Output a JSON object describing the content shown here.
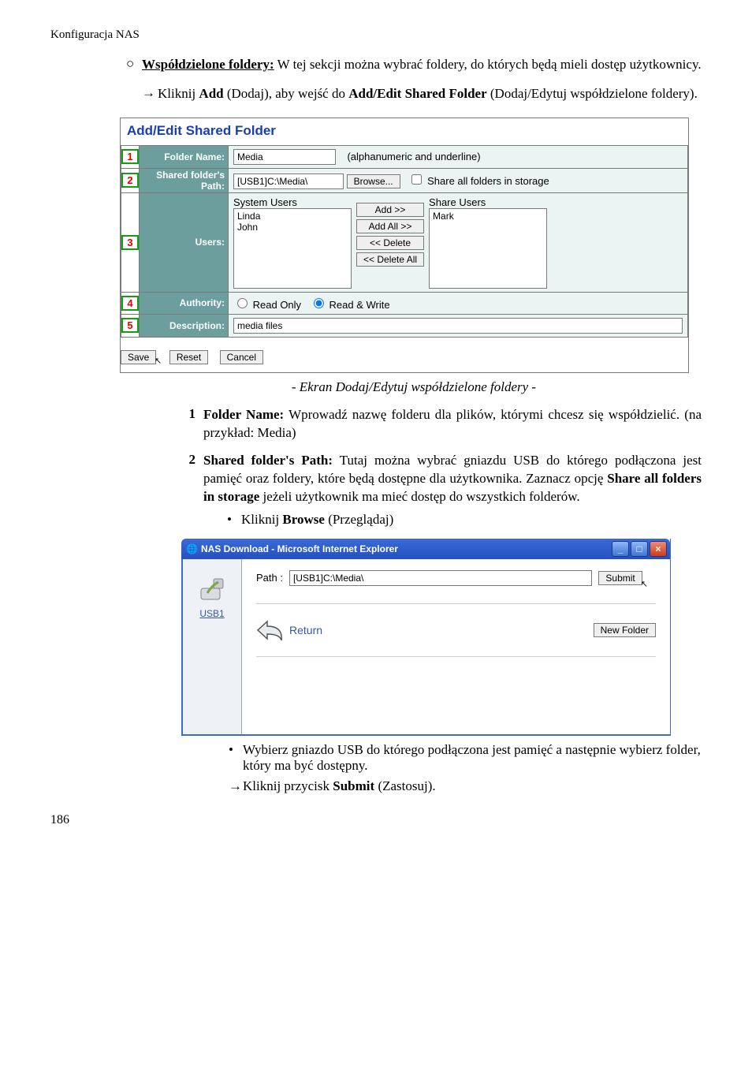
{
  "header": "Konfiguracja NAS",
  "shared_section": {
    "heading": "Współdzielone foldery:",
    "text": " W tej sekcji można wybrać foldery, do których będą mieli dostęp użytkownicy."
  },
  "click_add": {
    "pre": "Kliknij ",
    "bold": "Add",
    "mid1": " (Dodaj), aby wejść do ",
    "bold2": "Add/Edit Shared Folder",
    "post": " (Dodaj/Edytuj współdzielone foldery)."
  },
  "fig1": {
    "title": "Add/Edit Shared Folder",
    "rows": {
      "folder_name": {
        "num": "1",
        "label": "Folder Name:",
        "value": "Media",
        "hint": "(alphanumeric and underline)"
      },
      "path": {
        "num": "2",
        "label": "Shared folder's Path:",
        "value": "[USB1]C:\\Media\\",
        "browse": "Browse...",
        "share_all": "Share all folders in storage"
      },
      "users": {
        "num": "3",
        "label": "Users:",
        "system_title": "System Users",
        "system_list": [
          "Linda",
          "John"
        ],
        "btns": [
          "Add >>",
          "Add All >>",
          "<< Delete",
          "<< Delete All"
        ],
        "share_title": "Share Users",
        "share_list": [
          "Mark"
        ]
      },
      "authority": {
        "num": "4",
        "label": "Authority:",
        "opt1": "Read Only",
        "opt2": "Read & Write"
      },
      "description": {
        "num": "5",
        "label": "Description:",
        "value": "media files"
      }
    },
    "actions": {
      "save": "Save",
      "reset": "Reset",
      "cancel": "Cancel"
    }
  },
  "caption1": "- Ekran Dodaj/Edytuj współdzielone foldery -",
  "numbered": {
    "i1": {
      "n": "1",
      "bold": "Folder Name:",
      "text": " Wprowadź nazwę folderu dla plików, którymi chcesz się współdzielić. (na przykład: Media)"
    },
    "i2": {
      "n": "2",
      "bold": "Shared folder's Path:",
      "text1": " Tutaj można wybrać gniazdu USB do którego podłączona jest pamięć oraz foldery, które będą dostępne dla użytkownika. Zaznacz opcję ",
      "bold2": "Share all folders in storage",
      "text2": " jeżeli użytkownik ma mieć dostęp do wszystkich folderów.",
      "sub_pre": "Kliknij ",
      "sub_bold": "Browse",
      "sub_post": " (Przeglądaj)"
    }
  },
  "fig2": {
    "title": "NAS Download - Microsoft Internet Explorer",
    "side_label": "USB1",
    "path_label": "Path :",
    "path_value": "[USB1]C:\\Media\\",
    "submit": "Submit",
    "return": "Return",
    "new_folder": "New Folder"
  },
  "after_fig2": {
    "b1": "Wybierz gniazdo USB do którego podłączona jest pamięć a następnie wybierz folder, który ma być dostępny.",
    "arrow_pre": "Kliknij przycisk ",
    "arrow_bold": "Submit",
    "arrow_post": " (Zastosuj)."
  },
  "page_number": "186"
}
